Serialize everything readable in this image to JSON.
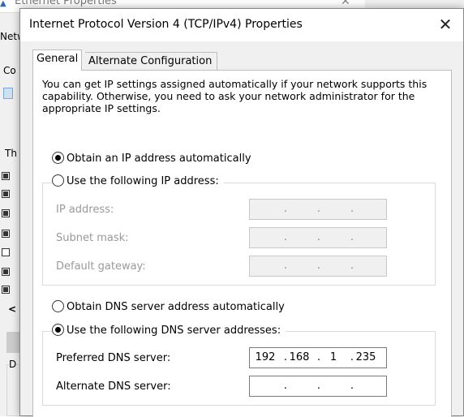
{
  "background_window": {
    "title": "Ethernet Properties",
    "tab_fragment": "Netw",
    "connect_fragment": "Co",
    "list_fragment": "Th",
    "scroll_left": "<",
    "desc_fragment": "D",
    "items_checked": [
      true,
      true,
      true,
      true,
      false,
      true,
      true
    ]
  },
  "dialog": {
    "title": "Internet Protocol Version 4 (TCP/IPv4) Properties",
    "close_glyph": "✕",
    "tabs": [
      {
        "label": "General",
        "active": true
      },
      {
        "label": "Alternate Configuration",
        "active": false
      }
    ],
    "info_text": "You can get IP settings assigned automatically if your network supports this capability. Otherwise, you need to ask your network administrator for the appropriate IP settings.",
    "ip_mode": {
      "auto_label": "Obtain an IP address automatically",
      "auto_selected": true,
      "manual_label": "Use the following IP address:",
      "manual_selected": false
    },
    "ip_fields": [
      {
        "label": "IP address:",
        "value": [
          "",
          "",
          "",
          ""
        ],
        "enabled": false
      },
      {
        "label": "Subnet mask:",
        "value": [
          "",
          "",
          "",
          ""
        ],
        "enabled": false
      },
      {
        "label": "Default gateway:",
        "value": [
          "",
          "",
          "",
          ""
        ],
        "enabled": false
      }
    ],
    "dns_mode": {
      "auto_label": "Obtain DNS server address automatically",
      "auto_selected": false,
      "manual_label": "Use the following DNS server addresses:",
      "manual_selected": true
    },
    "dns_fields": [
      {
        "label": "Preferred DNS server:",
        "value": [
          "192",
          "168",
          "1",
          "235"
        ],
        "enabled": true
      },
      {
        "label": "Alternate DNS server:",
        "value": [
          "",
          "",
          "",
          ""
        ],
        "enabled": true
      }
    ],
    "separator": "."
  }
}
